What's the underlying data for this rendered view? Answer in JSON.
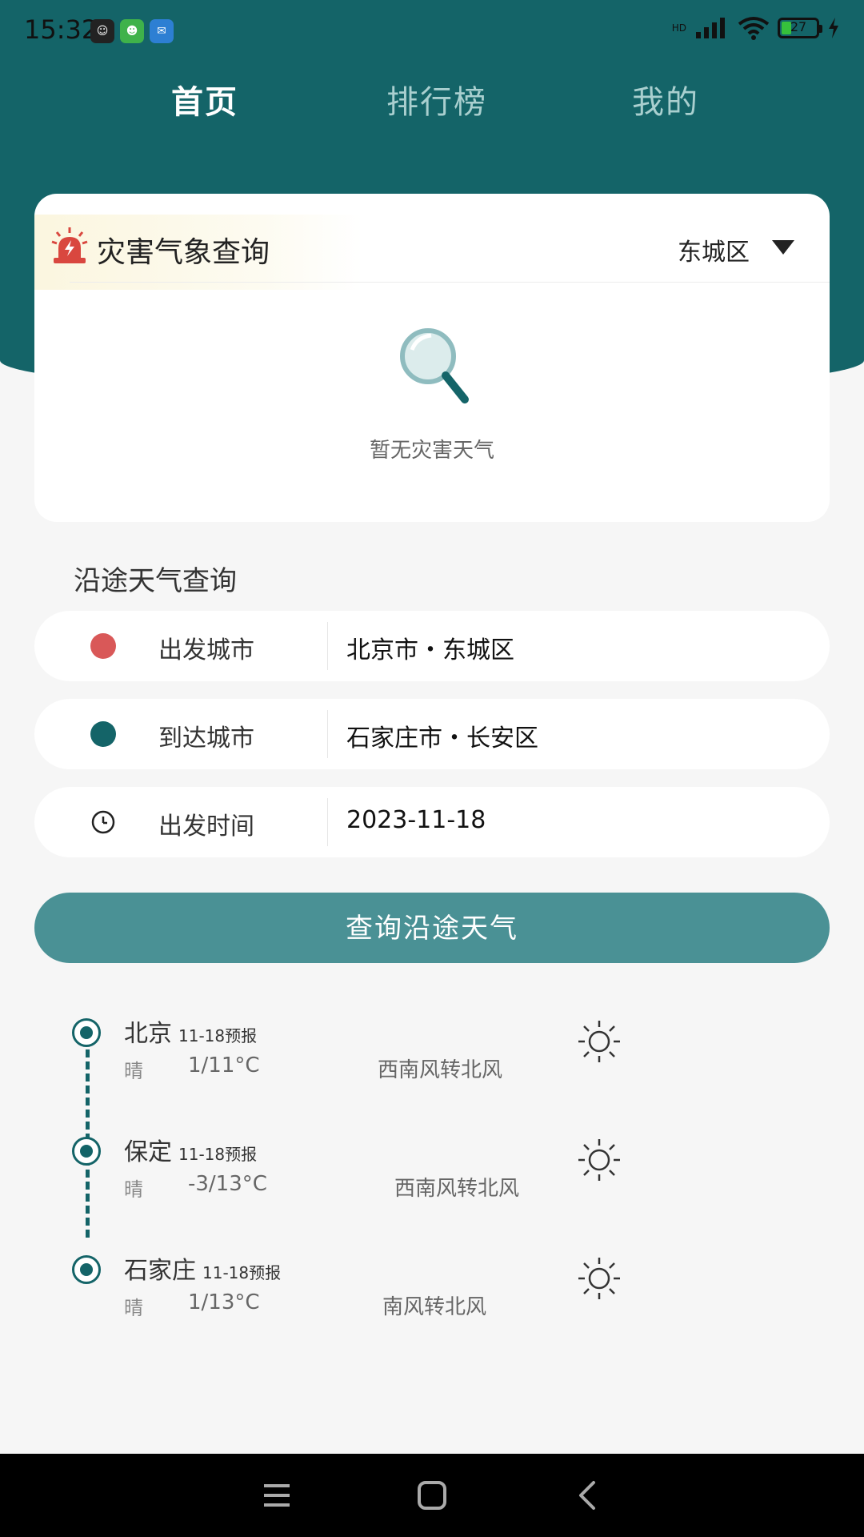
{
  "status_bar": {
    "time": "15:32",
    "battery": "27",
    "network": "HD"
  },
  "tabs": [
    {
      "label": "首页",
      "active": true
    },
    {
      "label": "排行榜",
      "active": false
    },
    {
      "label": "我的",
      "active": false
    }
  ],
  "disaster_card": {
    "title": "灾害气象查询",
    "district": "东城区",
    "empty_text": "暂无灾害天气"
  },
  "route": {
    "section_title": "沿途天气查询",
    "departure": {
      "label": "出发城市",
      "value": "北京市・东城区"
    },
    "arrival": {
      "label": "到达城市",
      "value": "石家庄市・长安区"
    },
    "time": {
      "label": "出发时间",
      "value": "2023-11-18"
    },
    "query_button": "查询沿途天气"
  },
  "stops": [
    {
      "city": "北京",
      "forecast": "11-18预报",
      "weather": "晴",
      "temp": "1/11°C",
      "wind": "西南风转北风"
    },
    {
      "city": "保定",
      "forecast": "11-18预报",
      "weather": "晴",
      "temp": "-3/13°C",
      "wind": "西南风转北风"
    },
    {
      "city": "石家庄",
      "forecast": "11-18预报",
      "weather": "晴",
      "temp": "1/13°C",
      "wind": "南风转北风"
    }
  ],
  "colors": {
    "primary": "#146468",
    "button": "#4a9195",
    "departure_dot": "#d95858",
    "arrival_dot": "#146468"
  }
}
